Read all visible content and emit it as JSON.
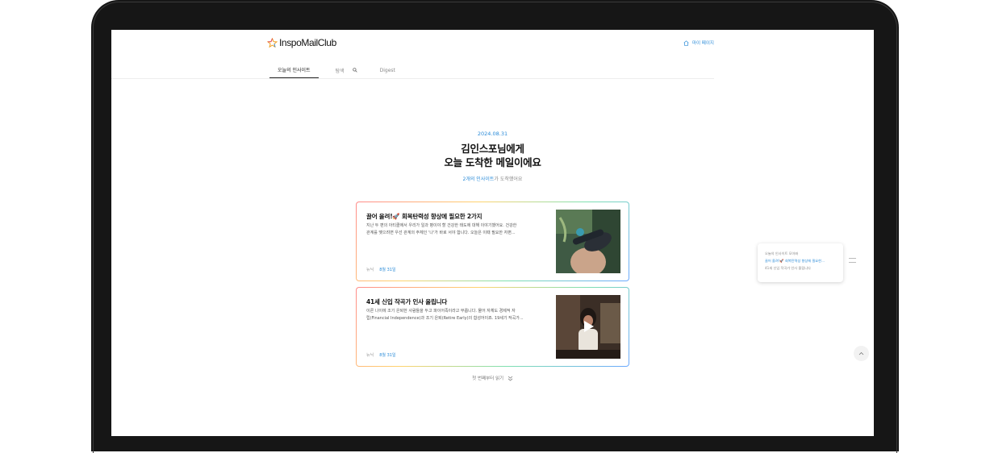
{
  "header": {
    "logo_text": "InspoMailClub",
    "mypage_label": "마이 페이지"
  },
  "nav": {
    "tabs": [
      {
        "label": "오늘의 인사이트",
        "active": true
      },
      {
        "label": "탐색",
        "icon": "search-icon"
      },
      {
        "label": "Digest"
      }
    ]
  },
  "main": {
    "date": "2024.08.31",
    "title_line1": "김인스포님에게",
    "title_line2": "오늘 도착한 메일이에요",
    "subtitle_highlight": "2개의 인사이트",
    "subtitle_rest": "가 도착했어요"
  },
  "cards": [
    {
      "title": "끌어 올려!🚀 회복탄력성 향상에 필요한 2가지",
      "desc_line1": "지난 두 편의 아티클에서 우리가 일과 병이야 할 건강한 태도에 대해 이야기했어요. 건강한",
      "desc_line2": "관계를 맺으려면 우선 관계의 주체인 '나'가 바로 서야 합니다. 오늘은 이때 필요한 자편...",
      "source": "뉴닉",
      "date": "8월 31일",
      "has_video": false
    },
    {
      "title": "41세 신입 작곡가 인사 올립니다",
      "desc_line1": "이른 나이에 조기 은퇴한 사람들을 두고 파이어족이라고 부릅니다. 물어 자체도 경제적 자",
      "desc_line2": "립(Financial Independence)과 조기 은퇴(Retire Early)의 합성어이죠. 19세기 작곡가...",
      "source": "뉴닉",
      "date": "8월 31일",
      "has_video": true
    }
  ],
  "read_more_label": "첫 번째부터 읽기",
  "toc": {
    "header": "오늘의 인사이트 모아봐",
    "items": [
      "끌어 올려!🚀 회복탄력성 향상에 필요한...",
      "41세 신입 작곡가 인사 올립니다"
    ]
  },
  "colors": {
    "accent": "#2a8bd8",
    "device_frame": "#161616"
  }
}
